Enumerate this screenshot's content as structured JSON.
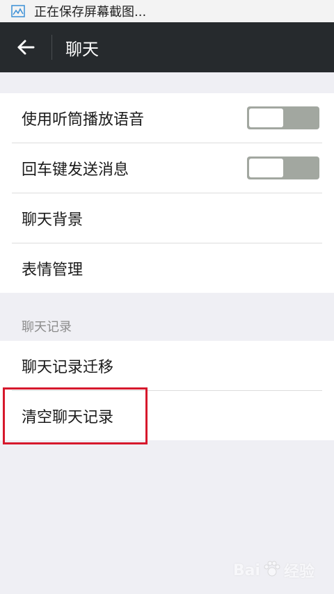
{
  "status_bar": {
    "text": "正在保存屏幕截图...",
    "icon": "screenshot-icon"
  },
  "app_bar": {
    "title": "聊天",
    "background": "#262a2d"
  },
  "settings": {
    "items": [
      {
        "label": "使用听筒播放语音",
        "toggle": true,
        "on": false
      },
      {
        "label": "回车键发送消息",
        "toggle": true,
        "on": false
      },
      {
        "label": "聊天背景"
      },
      {
        "label": "表情管理"
      }
    ]
  },
  "chat_history": {
    "header": "聊天记录",
    "items": [
      {
        "label": "聊天记录迁移"
      },
      {
        "label": "清空聊天记录",
        "highlighted": true
      }
    ]
  },
  "watermark": {
    "prefix": "Bai",
    "suffix": "经验"
  },
  "colors": {
    "highlight": "#d6182c",
    "toggle_track": "#a2a7a0",
    "background": "#efeff4"
  }
}
